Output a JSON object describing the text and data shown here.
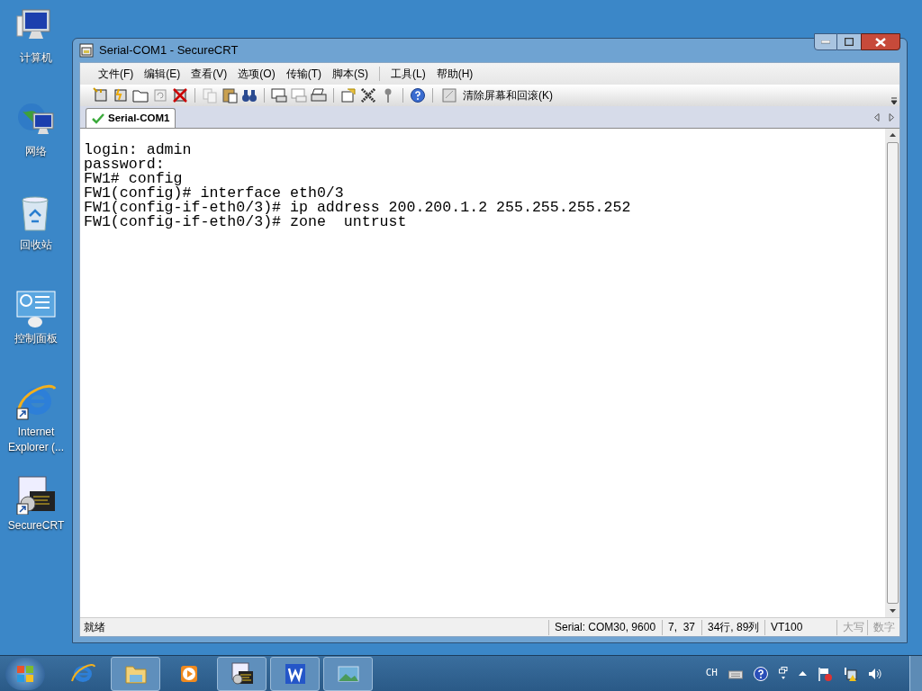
{
  "desktop_icons": [
    {
      "kind": "computer",
      "label": "计算机"
    },
    {
      "kind": "network",
      "label": "网络"
    },
    {
      "kind": "recycle",
      "label": "回收站"
    },
    {
      "kind": "control",
      "label": "控制面板"
    },
    {
      "kind": "ie",
      "label": "Internet Explorer (..."
    },
    {
      "kind": "crt",
      "label": "SecureCRT"
    }
  ],
  "window": {
    "title": "Serial-COM1 - SecureCRT"
  },
  "menu": [
    "文件(F)",
    "编辑(E)",
    "查看(V)",
    "选项(O)",
    "传输(T)",
    "脚本(S)",
    "工具(L)",
    "帮助(H)"
  ],
  "toolbar": {
    "clear_button": "清除屏幕和回滚(K)"
  },
  "tabs": [
    {
      "label": "Serial-COM1",
      "selected": true
    }
  ],
  "terminal": {
    "lines": [
      "login: admin",
      "password:",
      "FW1# config",
      "FW1(config)# interface eth0/3",
      "FW1(config-if-eth0/3)# ip address 200.200.1.2 255.255.255.252",
      "FW1(config-if-eth0/3)# zone  untrust"
    ]
  },
  "status_bar": {
    "message": "就绪",
    "panes": [
      {
        "text": "Serial: COM30, 9600",
        "disabled": false
      },
      {
        "text": "7,  37",
        "disabled": false
      },
      {
        "text": "34行, 89列",
        "disabled": false
      },
      {
        "text": "VT100",
        "disabled": false
      },
      {
        "text": "大写",
        "disabled": true
      },
      {
        "text": "数字",
        "disabled": true
      }
    ]
  },
  "taskbar": {
    "items": [
      {
        "kind": "ie",
        "running": false
      },
      {
        "kind": "folder",
        "running": true
      },
      {
        "kind": "media",
        "running": false
      },
      {
        "kind": "crt",
        "running": true
      },
      {
        "kind": "wps",
        "running": true
      },
      {
        "kind": "photo",
        "running": true
      }
    ],
    "language": "CH"
  }
}
